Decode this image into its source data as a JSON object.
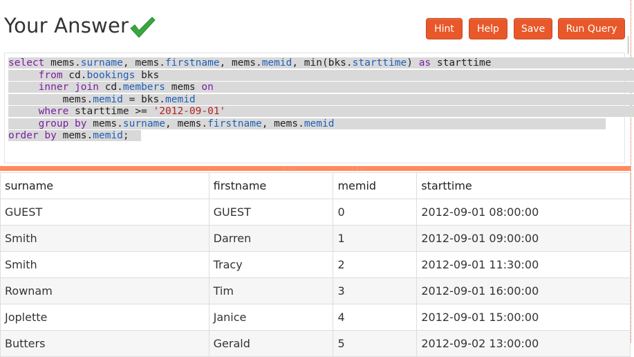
{
  "header": {
    "title": "Your Answer",
    "buttons": {
      "hint": "Hint",
      "help": "Help",
      "save": "Save",
      "run": "Run Query"
    },
    "accent_color": "#e8582a",
    "check_color": "#3aa640"
  },
  "editor": {
    "code": {
      "l1_kw": "select",
      "l1_a": " mems.",
      "l1_b": "surname",
      "l1_c": ", mems.",
      "l1_d": "firstname",
      "l1_e": ", mems.",
      "l1_f": "memid",
      "l1_g": ", min(bks.",
      "l1_h": "starttime",
      "l1_i": ") ",
      "l1_j": "as",
      "l1_k": " starttime",
      "l2_kw": "from",
      "l2_a": " cd.",
      "l2_b": "bookings",
      "l2_c": " bks",
      "l3_kw1": "inner",
      "l3_kw2": "join",
      "l3_a": " cd.",
      "l3_b": "members",
      "l3_c": " mems ",
      "l3_kw3": "on",
      "l4_a": "mems.",
      "l4_b": "memid",
      "l4_c": " = bks.",
      "l4_d": "memid",
      "l5_kw": "where",
      "l5_a": " starttime >= ",
      "l5_str": "'2012-09-01'",
      "l6_kw1": "group",
      "l6_kw2": "by",
      "l6_a": " mems.",
      "l6_b": "surname",
      "l6_c": ", mems.",
      "l6_d": "firstname",
      "l6_e": ", mems.",
      "l6_f": "memid",
      "l7_kw1": "order",
      "l7_kw2": "by",
      "l7_a": " mems.",
      "l7_b": "memid",
      "l7_c": ";"
    }
  },
  "results": {
    "columns": [
      "surname",
      "firstname",
      "memid",
      "starttime"
    ],
    "rows": [
      [
        "GUEST",
        "GUEST",
        "0",
        "2012-09-01 08:00:00"
      ],
      [
        "Smith",
        "Darren",
        "1",
        "2012-09-01 09:00:00"
      ],
      [
        "Smith",
        "Tracy",
        "2",
        "2012-09-01 11:30:00"
      ],
      [
        "Rownam",
        "Tim",
        "3",
        "2012-09-01 16:00:00"
      ],
      [
        "Joplette",
        "Janice",
        "4",
        "2012-09-01 15:00:00"
      ],
      [
        "Butters",
        "Gerald",
        "5",
        "2012-09-02 13:00:00"
      ]
    ]
  }
}
